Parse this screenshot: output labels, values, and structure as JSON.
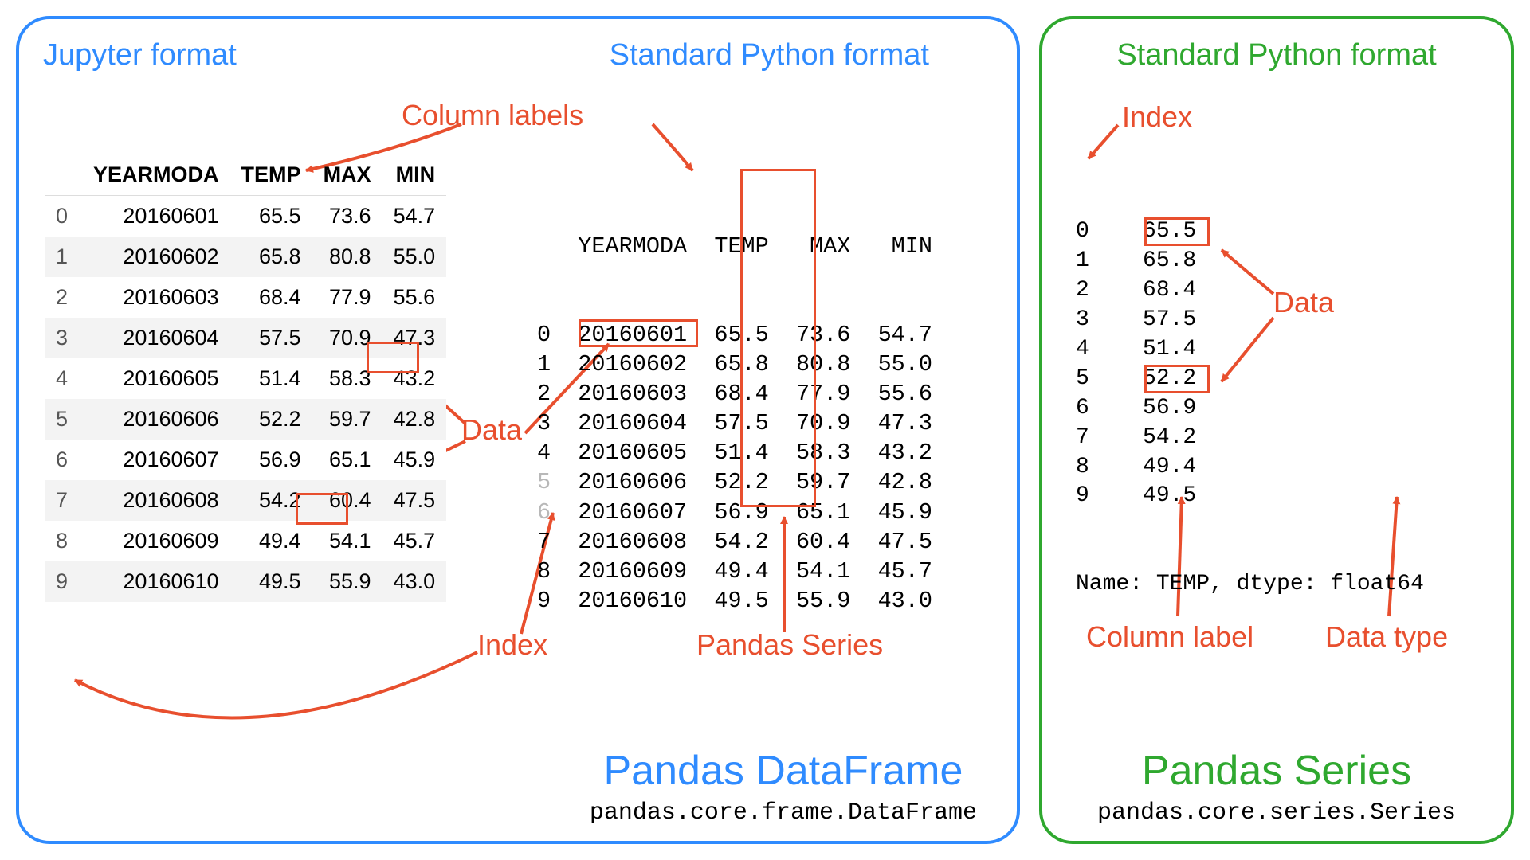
{
  "left": {
    "title_jupyter": "Jupyter format",
    "title_std": "Standard Python format",
    "big": "Pandas DataFrame",
    "module": "pandas.core.frame.DataFrame",
    "columns": [
      "YEARMODA",
      "TEMP",
      "MAX",
      "MIN"
    ],
    "rows": [
      {
        "i": "0",
        "yearmoda": "20160601",
        "temp": "65.5",
        "max": "73.6",
        "min": "54.7"
      },
      {
        "i": "1",
        "yearmoda": "20160602",
        "temp": "65.8",
        "max": "80.8",
        "min": "55.0"
      },
      {
        "i": "2",
        "yearmoda": "20160603",
        "temp": "68.4",
        "max": "77.9",
        "min": "55.6"
      },
      {
        "i": "3",
        "yearmoda": "20160604",
        "temp": "57.5",
        "max": "70.9",
        "min": "47.3"
      },
      {
        "i": "4",
        "yearmoda": "20160605",
        "temp": "51.4",
        "max": "58.3",
        "min": "43.2"
      },
      {
        "i": "5",
        "yearmoda": "20160606",
        "temp": "52.2",
        "max": "59.7",
        "min": "42.8"
      },
      {
        "i": "6",
        "yearmoda": "20160607",
        "temp": "56.9",
        "max": "65.1",
        "min": "45.9"
      },
      {
        "i": "7",
        "yearmoda": "20160608",
        "temp": "54.2",
        "max": "60.4",
        "min": "47.5"
      },
      {
        "i": "8",
        "yearmoda": "20160609",
        "temp": "49.4",
        "max": "54.1",
        "min": "45.7"
      },
      {
        "i": "9",
        "yearmoda": "20160610",
        "temp": "49.5",
        "max": "55.9",
        "min": "43.0"
      }
    ],
    "std_header": "   YEARMODA  TEMP   MAX   MIN",
    "std_rows": [
      "0  20160601  65.5  73.6  54.7",
      "1  20160602  65.8  80.8  55.0",
      "2  20160603  68.4  77.9  55.6",
      "3  20160604  57.5  70.9  47.3",
      "4  20160605  51.4  58.3  43.2",
      "5  20160606  52.2  59.7  42.8",
      "6  20160607  56.9  65.1  45.9",
      "7  20160608  54.2  60.4  47.5",
      "8  20160609  49.4  54.1  45.7",
      "9  20160610  49.5  55.9  43.0"
    ],
    "labels": {
      "column_labels": "Column labels",
      "data": "Data",
      "index": "Index",
      "series": "Pandas Series"
    }
  },
  "right": {
    "title_std": "Standard Python format",
    "big": "Pandas Series",
    "module": "pandas.core.series.Series",
    "rows": [
      "0    65.5",
      "1    65.8",
      "2    68.4",
      "3    57.5",
      "4    51.4",
      "5    52.2",
      "6    56.9",
      "7    54.2",
      "8    49.4",
      "9    49.5"
    ],
    "footer": "Name: TEMP, dtype: float64",
    "labels": {
      "index": "Index",
      "data": "Data",
      "column_label": "Column label",
      "data_type": "Data type"
    }
  }
}
